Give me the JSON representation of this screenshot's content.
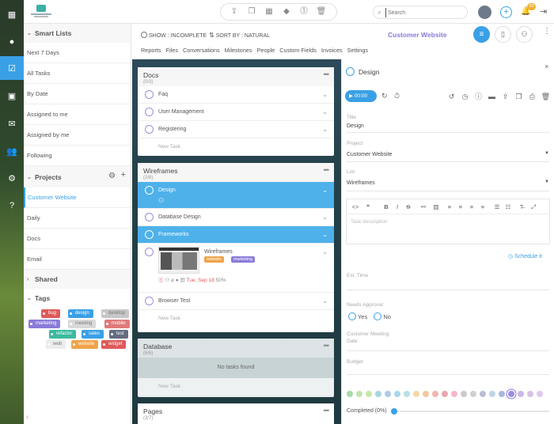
{
  "header": {
    "search_placeholder": "Search",
    "badge_count": "99"
  },
  "left": {
    "smart_lists_title": "Smart Lists",
    "smart_lists": [
      "Next 7 Days",
      "All Tasks",
      "By Date",
      "Assigned to me",
      "Assigned by me",
      "Following"
    ],
    "projects_title": "Projects",
    "projects": [
      "Customer Website",
      "Daily",
      "Docs",
      "Email"
    ],
    "shared_title": "Shared",
    "tags_title": "Tags",
    "tags": [
      {
        "name": "bug",
        "color": "#e05a5a"
      },
      {
        "name": "design",
        "color": "#3aa0e6"
      },
      {
        "name": "desktop",
        "color": "#c7c7c7"
      },
      {
        "name": "marketing",
        "color": "#8b7bd8"
      },
      {
        "name": "meeting",
        "color": "#d9d9d9"
      },
      {
        "name": "mobile",
        "color": "#e07a7a"
      },
      {
        "name": "refactor",
        "color": "#3cb9a0"
      },
      {
        "name": "sales",
        "color": "#3aa0e6"
      },
      {
        "name": "test",
        "color": "#666c80"
      },
      {
        "name": "web",
        "color": "#ececec"
      },
      {
        "name": "website",
        "color": "#f0a34a"
      },
      {
        "name": "widget",
        "color": "#e05a5a"
      }
    ]
  },
  "toolbar": {
    "show_label": "SHOW : INCOMPLETE",
    "sort_label": "SORT BY : NATURAL",
    "project_title": "Customer Website"
  },
  "tabs": [
    "Reports",
    "Files",
    "Conversations",
    "Milestones",
    "People",
    "Custom Fields",
    "Invoices",
    "Settings"
  ],
  "board": {
    "columns": [
      {
        "title": "Docs",
        "count": "(0/3)",
        "tasks": [
          "Faq",
          "User Management",
          "Registering"
        ],
        "new_task": "New Task"
      },
      {
        "title": "Wireframes",
        "count": "(2/8)",
        "tasks": [
          "Design",
          "Database Design",
          "Frameworks",
          "Wireframes",
          "Browser Test"
        ],
        "new_task": "New Task",
        "card": {
          "tags": [
            "website",
            "marketing"
          ],
          "date": "Tue, Sep 18",
          "progress": "50%"
        }
      },
      {
        "title": "Database",
        "count": "(6/6)",
        "empty": "No tasks found",
        "new_task": "New Task"
      },
      {
        "title": "Pages",
        "count": "(3/7)"
      }
    ]
  },
  "detail": {
    "title": "Design",
    "timer": "00:00",
    "fields": [
      {
        "label": "Title",
        "value": "Design"
      },
      {
        "label": "Project",
        "value": "Customer Website"
      },
      {
        "label": "List",
        "value": "Wireframes"
      }
    ],
    "description_placeholder": "Task description",
    "schedule_label": "Schedule it",
    "est_time_label": "Est. Time",
    "needs_approval_label": "Needs Approval",
    "yes_label": "Yes",
    "no_label": "No",
    "meeting_date_label": "Customer Meeting Date",
    "budget_label": "Budget",
    "completed_label": "Completed (0%)",
    "colors": [
      "#a9d8a9",
      "#bfe3b0",
      "#c9e6a8",
      "#a9d5e0",
      "#b0c9ea",
      "#a8d7f0",
      "#b6e0e6",
      "#f5d9a6",
      "#f3c8a0",
      "#f0b6b0",
      "#e8a6b0",
      "#f5b6c8",
      "#c9c9c9",
      "#d0d0d0",
      "#bcbcd8",
      "#c0d6e8",
      "#a8b8e0",
      "#9b8ee0",
      "#c8b8e8",
      "#d8c0e8",
      "#e0c8f0"
    ]
  }
}
